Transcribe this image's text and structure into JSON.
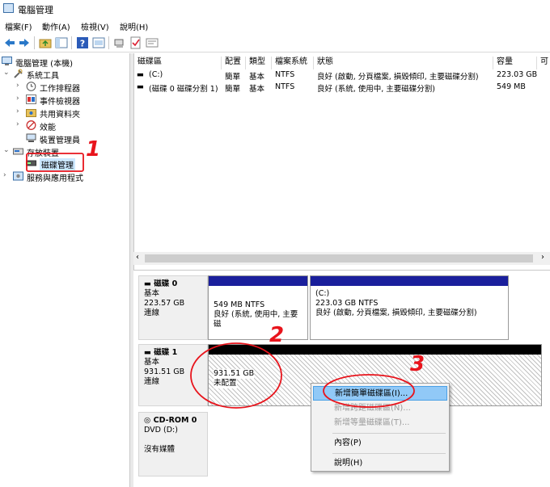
{
  "window": {
    "title": "電腦管理"
  },
  "menubar": [
    "檔案(F)",
    "動作(A)",
    "檢視(V)",
    "說明(H)"
  ],
  "tree": {
    "items": [
      {
        "label": "電腦管理 (本機)",
        "icon": "computer-management-icon",
        "expander": ""
      },
      {
        "label": "系統工具",
        "icon": "tools-icon",
        "expander": "⌄"
      },
      {
        "label": "工作排程器",
        "icon": "clock-icon",
        "expander": "›"
      },
      {
        "label": "事件檢視器",
        "icon": "event-viewer-icon",
        "expander": "›"
      },
      {
        "label": "共用資料夾",
        "icon": "shared-folder-icon",
        "expander": "›"
      },
      {
        "label": "效能",
        "icon": "performance-icon",
        "expander": "›"
      },
      {
        "label": "裝置管理員",
        "icon": "device-manager-icon",
        "expander": ""
      },
      {
        "label": "存放裝置",
        "icon": "storage-icon",
        "expander": "⌄"
      },
      {
        "label": "磁碟管理",
        "icon": "disk-management-icon",
        "expander": ""
      },
      {
        "label": "服務與應用程式",
        "icon": "services-icon",
        "expander": "›"
      }
    ]
  },
  "volume_table": {
    "headers": [
      "磁碟區",
      "配置",
      "類型",
      "檔案系統",
      "狀態",
      "容量",
      "可"
    ],
    "rows": [
      [
        "(C:)",
        "簡單",
        "基本",
        "NTFS",
        "良好 (啟動, 分頁檔案, 損毀傾印, 主要磁碟分割)",
        "223.03 GB"
      ],
      [
        "(磁碟 0 磁碟分割 1)",
        "簡單",
        "基本",
        "NTFS",
        "良好 (系統, 使用中, 主要磁碟分割)",
        "549 MB"
      ]
    ]
  },
  "disks": [
    {
      "name": "磁碟 0",
      "type": "基本",
      "size": "223.57 GB",
      "status": "連線",
      "partitions": [
        {
          "line1": "549 MB NTFS",
          "line2": "良好 (系統, 使用中, 主要磁",
          "title": ""
        },
        {
          "title": "(C:)",
          "line1": "223.03 GB NTFS",
          "line2": "良好 (啟動, 分頁檔案, 損毀傾印, 主要磁碟分割)"
        }
      ]
    },
    {
      "name": "磁碟 1",
      "type": "基本",
      "size": "931.51 GB",
      "status": "連線",
      "partitions": [
        {
          "line1": "931.51 GB",
          "line2": "未配置"
        }
      ]
    },
    {
      "name": "CD-ROM 0",
      "type": "DVD (D:)",
      "size": "",
      "status": "沒有媒體"
    }
  ],
  "context_menu": {
    "items": [
      {
        "label": "新增簡單磁碟區(I)...",
        "state": "highlighted"
      },
      {
        "label": "新增跨距磁碟區(N)...",
        "state": "disabled"
      },
      {
        "label": "新增等量磁碟區(T)...",
        "state": "disabled"
      },
      {
        "label": "內容(P)",
        "state": "normal"
      },
      {
        "label": "說明(H)",
        "state": "normal"
      }
    ]
  },
  "annotations": [
    "1",
    "2",
    "3"
  ],
  "colors": {
    "annotation": "#e8141c",
    "partition_bar": "#1a1f9c",
    "highlight": "#91c9f7"
  }
}
